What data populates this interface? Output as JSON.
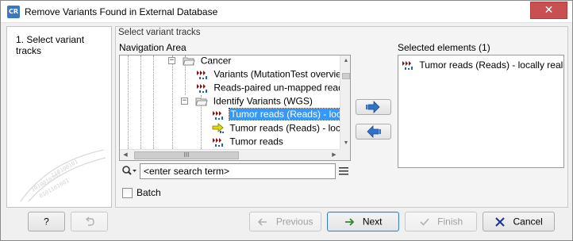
{
  "window": {
    "app_icon_text": "CR",
    "title": "Remove Variants Found in External Database",
    "close_glyph": "✕"
  },
  "steps": {
    "items": [
      {
        "label": "1.  Select variant tracks"
      }
    ]
  },
  "main": {
    "section_title": "Select variant tracks",
    "navigation_area_label": "Navigation Area",
    "tree": [
      {
        "label": "Cancer",
        "icon": "folder-open-icon",
        "expander": "−"
      },
      {
        "label": "Variants (MutationTest overview, ",
        "icon": "variant-track-icon"
      },
      {
        "label": "Reads-paired un-mapped reads (",
        "icon": "variant-track-icon"
      },
      {
        "label": "Identify Variants (WGS)",
        "icon": "folder-open-icon",
        "expander": "−"
      },
      {
        "label": "Tumor reads (Reads) - locally",
        "icon": "variant-track-icon",
        "selected": true
      },
      {
        "label": "Tumor reads (Reads) - locally",
        "icon": "arrow-track-icon"
      },
      {
        "label": "Tumor reads",
        "icon": "variant-track-icon"
      }
    ],
    "hscroll_thumb_grip": "III",
    "search": {
      "placeholder": "<enter search term>",
      "value": ""
    },
    "batch_label": "Batch",
    "batch_checked": false,
    "add_button_icon": "right-arrow-icon",
    "remove_button_icon": "left-arrow-icon",
    "selected_elements_label": "Selected elements (1)",
    "selected_elements": [
      {
        "label": "Tumor reads (Reads) - locally real...",
        "icon": "variant-track-icon"
      }
    ]
  },
  "buttons": {
    "help_label": "?",
    "reset_icon": "reset-icon",
    "previous_label": "Previous",
    "next_label": "Next",
    "finish_label": "Finish",
    "cancel_label": "Cancel"
  },
  "colors": {
    "selection": "#3399ff",
    "accent_blue": "#1f5fbf",
    "cancel_x": "#203a8a",
    "next_arrow": "#2a8a2a",
    "close_button": "#c75050"
  }
}
